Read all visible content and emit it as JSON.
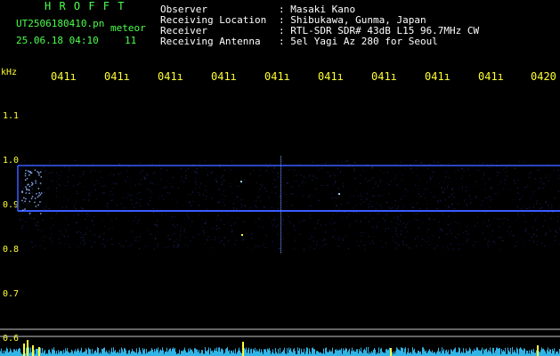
{
  "header": {
    "program": "H R O F F T",
    "filename": "UT2506180410.pn",
    "meteor_label": "meteor",
    "datetime": "25.06.18 04:10",
    "count": "11",
    "info_labels": [
      "Observer",
      "Receiving Location",
      "Receiver",
      "Receiving Antenna"
    ],
    "info_values": [
      ": Masaki Kano",
      ": Shibukawa, Gunma, Japan",
      ": RTL-SDR SDR# 43dB L15 96.7MHz CW",
      ": 5el Yagi Az 280 for Seoul"
    ]
  },
  "time_axis": {
    "labels": [
      "041ı",
      "041ı",
      "041ı",
      "041ı",
      "041ı",
      "041ı",
      "041ı",
      "041ı",
      "041ı",
      "0420"
    ]
  },
  "freq_axis": {
    "unit": "kHz",
    "labels": [
      "1.1",
      "1.0",
      "0.9",
      "0.8",
      "0.7",
      "0.6"
    ]
  },
  "colors": {
    "band": "#3a5cff",
    "grid": "#c8c8c8",
    "noise": "#35c8ff",
    "meteor": "#ffff33",
    "text_green": "#4cff4c",
    "text_yellow": "#ffff33"
  }
}
